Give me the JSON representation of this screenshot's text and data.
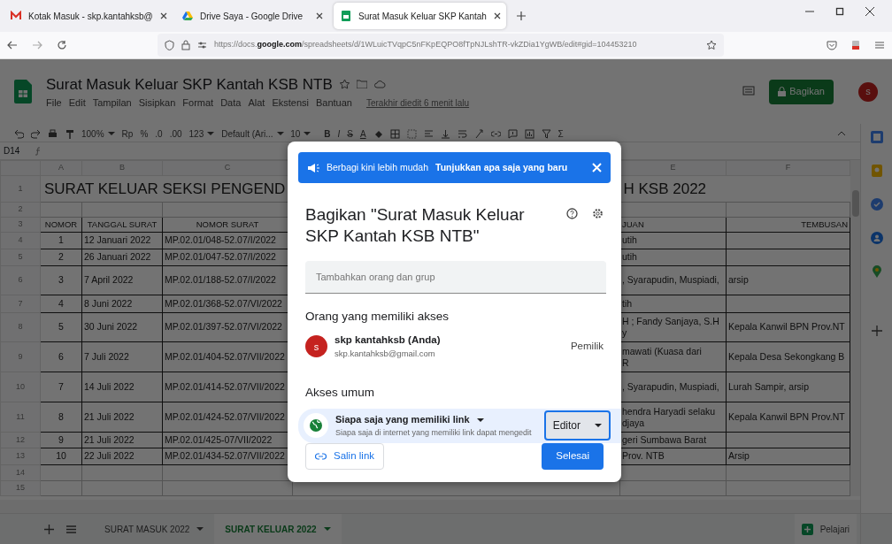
{
  "browser": {
    "tabs": [
      {
        "title": "Kotak Masuk - skp.kantahksb@",
        "selected": false
      },
      {
        "title": "Drive Saya - Google Drive",
        "selected": false
      },
      {
        "title": "Surat Masuk Keluar SKP Kantah",
        "selected": true
      }
    ],
    "url_prefix": "https://docs.",
    "url_domain": "google.com",
    "url_rest": "/spreadsheets/d/1WLuicTVqpC5nFKpEQPO8fTpNJLshTR-vkZDia1YgWB/edit#gid=104453210"
  },
  "sheets": {
    "title": "Surat Masuk Keluar SKP Kantah KSB NTB",
    "menus": [
      "File",
      "Edit",
      "Tampilan",
      "Sisipkan",
      "Format",
      "Data",
      "Alat",
      "Ekstensi",
      "Bantuan"
    ],
    "last_edit": "Terakhir diedit 6 menit lalu",
    "share_button": "Bagikan",
    "account_initial": "s",
    "toolbar": [
      "100%",
      "Rp",
      "%",
      ".0",
      ".00",
      "123",
      "Default (Ari...",
      "10",
      "B",
      "I",
      "S",
      "A"
    ],
    "sum_symbol": "Σ",
    "name_box": "D14",
    "columns": [
      "A",
      "B",
      "C",
      "",
      "E",
      "F"
    ],
    "rows": [
      {
        "number": "1",
        "kind": "title",
        "cells": [
          {
            "text": "SURAT KELUAR SEKSI PENGEND",
            "colspan": 3
          },
          "",
          {
            "text": "H KSB 2022",
            "colspan": 2
          }
        ]
      },
      {
        "number": "2",
        "kind": "empty",
        "cells": []
      },
      {
        "number": "3",
        "kind": "header",
        "cells": [
          "NOMOR",
          "TANGGAL SURAT",
          "NOMOR SURAT",
          "",
          "JUAN",
          "TEMBUSAN"
        ]
      },
      {
        "number": "4",
        "kind": "data",
        "cells": [
          "1",
          "12 Januari 2022",
          "MP.02.01/048-52.07/I/2022",
          "",
          "utih",
          ""
        ]
      },
      {
        "number": "5",
        "kind": "data",
        "cells": [
          "2",
          "26 Januari 2022",
          "MP.02.01/047-52.07/I/2022",
          "",
          "utih",
          ""
        ]
      },
      {
        "number": "6",
        "kind": "data",
        "cells": [
          "3",
          "7 April 2022",
          "MP.02.01/188-52.07/I/2022",
          "",
          ", Syarapudin, Muspiadi,",
          "arsip"
        ]
      },
      {
        "number": "7",
        "kind": "data",
        "cells": [
          "4",
          "8 Juni 2022",
          "MP.02.01/368-52.07/VI/2022",
          "",
          "tih",
          ""
        ]
      },
      {
        "number": "8",
        "kind": "data",
        "cells": [
          "5",
          "30 Juni 2022",
          "MP.02.01/397-52.07/VI/2022",
          "",
          "H ; Fandy Sanjaya, S.H\ny",
          "Kepala Kanwil BPN Prov.NT"
        ]
      },
      {
        "number": "9",
        "kind": "data",
        "cells": [
          "6",
          "7 Juli 2022",
          "MP.02.01/404-52.07/VII/2022",
          "",
          "mawati (Kuasa dari\nR",
          "Kepala Desa Sekongkang B"
        ]
      },
      {
        "number": "10",
        "kind": "data",
        "cells": [
          "7",
          "14 Juli 2022",
          "MP.02.01/414-52.07/VII/2022",
          "",
          ", Syarapudin, Muspiadi,",
          "Lurah Sampir, arsip"
        ]
      },
      {
        "number": "11",
        "kind": "data",
        "cells": [
          "8",
          "21 Juli 2022",
          "MP.02.01/424-52.07/VII/2022",
          "",
          "hendra Haryadi selaku\ndjaya",
          "Kepala Kanwil BPN Prov.NT"
        ]
      },
      {
        "number": "12",
        "kind": "data",
        "cells": [
          "9",
          "21 Juli 2022",
          "MP.02.01/425-07/VII/2022",
          "",
          "geri Sumbawa Barat",
          ""
        ]
      },
      {
        "number": "13",
        "kind": "data",
        "cells": [
          "10",
          "22 Juli 2022",
          "MP.02.01/434-52.07/VII/2022",
          "",
          "Prov. NTB",
          "Arsip"
        ]
      },
      {
        "number": "14",
        "kind": "empty",
        "cells": []
      },
      {
        "number": "15",
        "kind": "empty",
        "cells": []
      }
    ],
    "sheet_tabs": [
      {
        "label": "SURAT MASUK 2022",
        "selected": false
      },
      {
        "label": "SURAT KELUAR 2022",
        "selected": true
      }
    ],
    "explore": "Pelajari"
  },
  "dialog": {
    "banner": {
      "text": "Berbagi kini lebih mudah",
      "link": "Tunjukkan apa saja yang baru"
    },
    "title": "Bagikan \"Surat Masuk Keluar SKP Kantah KSB NTB\"",
    "field": {
      "placeholder": "Tambahkan orang dan grup"
    },
    "people_heading": "Orang yang memiliki akses",
    "person": {
      "initial": "s",
      "name": "skp kantahksb (Anda)",
      "email": "skp.kantahksb@gmail.com",
      "role": "Pemilik"
    },
    "general_heading": "Akses umum",
    "access": {
      "label": "Siapa saja yang memiliki link",
      "description": "Siapa saja di internet yang memiliki link dapat mengedit",
      "role": "Editor"
    },
    "copy_link": "Salin link",
    "done": "Selesai"
  }
}
